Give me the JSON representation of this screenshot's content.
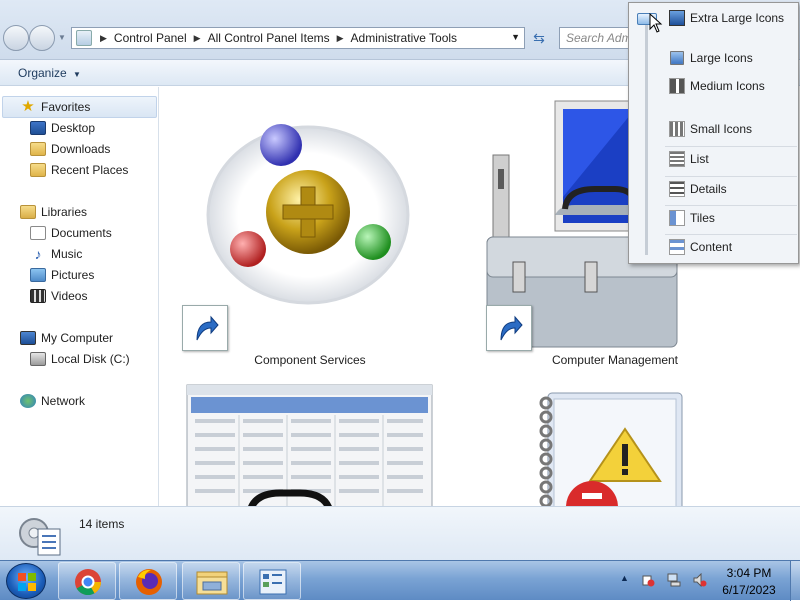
{
  "address_bar": {
    "breadcrumb": [
      "Control Panel",
      "All Control Panel Items",
      "Administrative Tools"
    ],
    "search_placeholder": "Search Administrative Tools"
  },
  "toolbar": {
    "organize_label": "Organize"
  },
  "nav_pane": {
    "favorites": {
      "label": "Favorites",
      "items": [
        "Desktop",
        "Downloads",
        "Recent Places"
      ]
    },
    "libraries": {
      "label": "Libraries",
      "items": [
        "Documents",
        "Music",
        "Pictures",
        "Videos"
      ]
    },
    "computer": {
      "label": "My Computer",
      "items": [
        "Local Disk (C:)"
      ]
    },
    "network": {
      "label": "Network"
    }
  },
  "content": {
    "items": [
      {
        "label": "Component Services",
        "icon": "component-services-icon"
      },
      {
        "label": "Computer Management",
        "icon": "computer-management-icon"
      },
      {
        "label": "",
        "icon": "data-sources-icon"
      },
      {
        "label": "",
        "icon": "event-viewer-icon"
      }
    ]
  },
  "status_bar": {
    "count": "14 items"
  },
  "view_menu": {
    "items": [
      "Extra Large Icons",
      "Large Icons",
      "Medium Icons",
      "Small Icons",
      "List",
      "Details",
      "Tiles",
      "Content"
    ],
    "selected": "Extra Large Icons"
  },
  "taskbar": {
    "apps": [
      "chrome-icon",
      "firefox-icon",
      "file-explorer-icon",
      "control-panel-icon"
    ],
    "time": "3:04 PM",
    "date": "6/17/2023"
  },
  "colors": {
    "accent": "#3a6fb0",
    "taskbar": "#7aa3d4"
  }
}
